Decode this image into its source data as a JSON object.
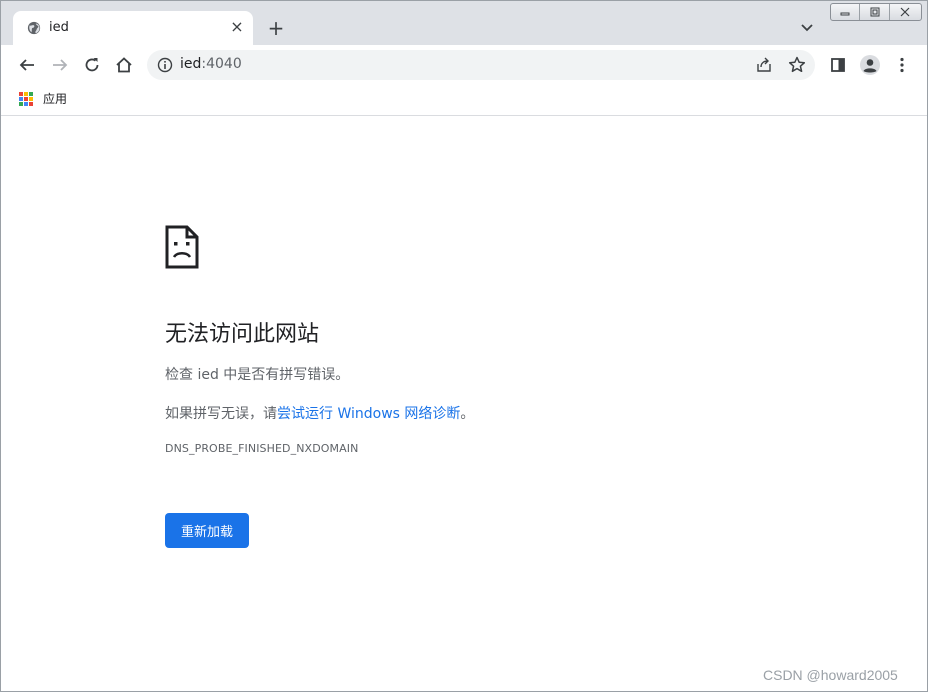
{
  "tab": {
    "title": "ied",
    "close_glyph": "×",
    "favicon": "globe-icon"
  },
  "new_tab_glyph": "+",
  "omnibox": {
    "host": "ied",
    "port": ":4040"
  },
  "bookmarks": {
    "apps_label": "应用"
  },
  "error": {
    "title": "无法访问此网站",
    "check_line": "检查 ied 中是否有拼写错误。",
    "suggest_prefix": "如果拼写无误，请",
    "suggest_link": "尝试运行 Windows 网络诊断",
    "suggest_suffix": "。",
    "code": "DNS_PROBE_FINISHED_NXDOMAIN",
    "reload_label": "重新加载"
  },
  "watermark": "CSDN @howard2005",
  "colors": {
    "accent": "#1a73e8",
    "tabstrip": "#dee1e6",
    "omnibox_bg": "#f1f3f4",
    "text_secondary": "#5f6368"
  }
}
